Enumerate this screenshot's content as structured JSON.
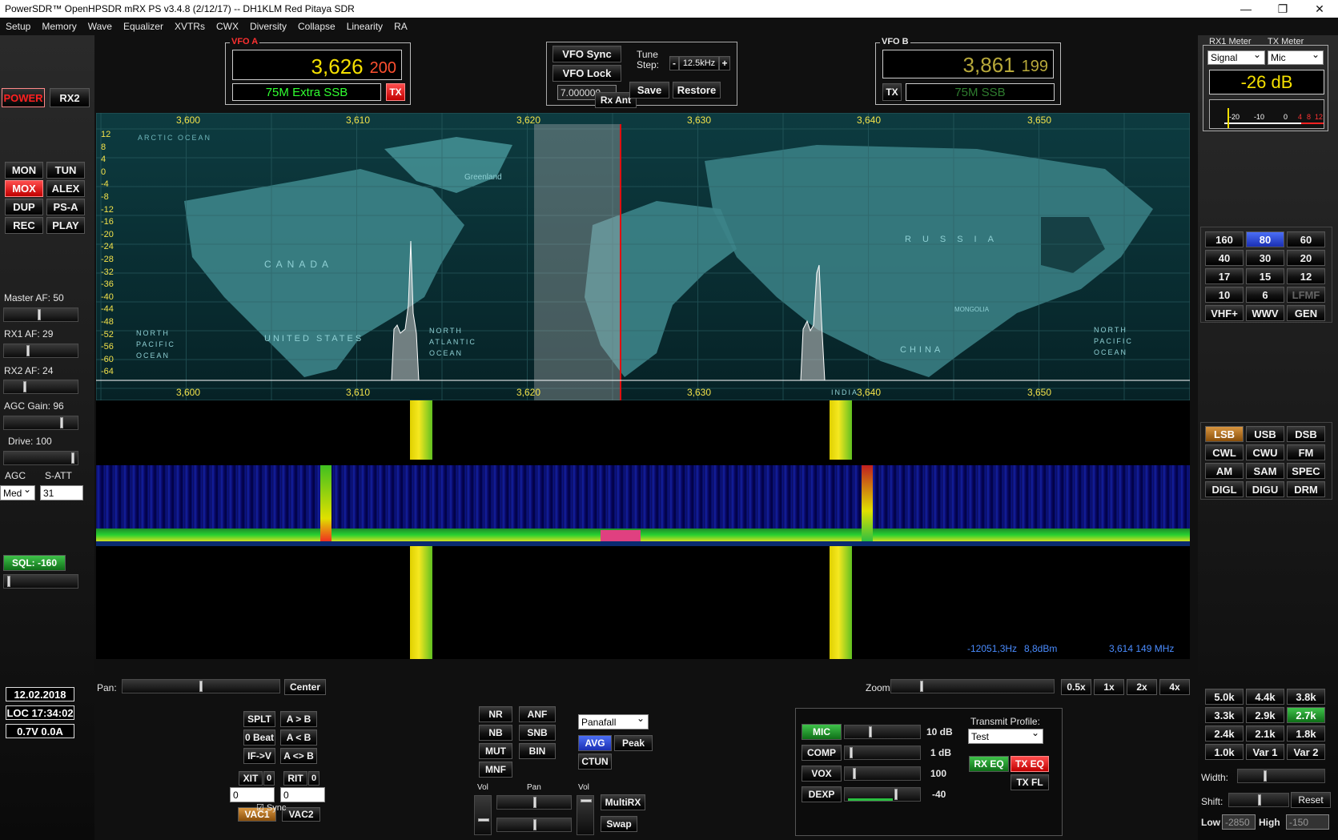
{
  "window": {
    "title": "PowerSDR™ OpenHPSDR mRX PS v3.4.8 (2/12/17)   --   DH1KLM Red Pitaya SDR",
    "minimize": "—",
    "maximize": "❐",
    "close": "✕"
  },
  "menu": [
    "Setup",
    "Memory",
    "Wave",
    "Equalizer",
    "XVTRs",
    "CWX",
    "Diversity",
    "Collapse",
    "Linearity",
    "RA"
  ],
  "power": {
    "power": "POWER",
    "rx2": "RX2"
  },
  "tx_buttons": [
    "MON",
    "TUN",
    "MOX",
    "ALEX",
    "DUP",
    "PS-A",
    "REC",
    "PLAY"
  ],
  "controls": {
    "master_af": "Master AF:  50",
    "rx1_af": "RX1 AF:  29",
    "rx2_af": "RX2 AF:  24",
    "agc_gain": "AGC Gain:  96",
    "drive": "Drive:  100",
    "agc": "AGC",
    "satt": "S-ATT",
    "agc_value": "Med",
    "satt_value": "31",
    "sql": "SQL: -160"
  },
  "status": {
    "date": "12.02.2018",
    "time": "LOC 17:34:02",
    "power": "0.7V 0.0A"
  },
  "vfo_a": {
    "caption": "VFO A",
    "mhz": "3,626",
    "hz": "200",
    "band": "75M Extra SSB",
    "tx": "TX"
  },
  "vfo_b": {
    "caption": "VFO B",
    "mhz": "3,861",
    "hz": "199",
    "band": "75M SSB",
    "tx": "TX"
  },
  "vfo_center": {
    "sync": "VFO Sync",
    "lock": "VFO Lock",
    "tune": "Tune",
    "step_label": "Step:",
    "minus": "-",
    "step": "12.5kHz",
    "plus": "+",
    "save": "Save",
    "restore": "Restore",
    "freq": "7.000000",
    "rx_ant": "Rx Ant"
  },
  "meter": {
    "rx1_label": "RX1 Meter",
    "tx_label": "TX Meter",
    "rx_sel": "Signal",
    "tx_sel": "Mic",
    "reading": "-26 dB",
    "scale": [
      "-20",
      "-10",
      "0",
      "4",
      "8",
      "12"
    ]
  },
  "bands": [
    "160",
    "80",
    "60",
    "40",
    "30",
    "20",
    "17",
    "15",
    "12",
    "10",
    "6",
    "LFMF",
    "VHF+",
    "WWV",
    "GEN"
  ],
  "modes": [
    "LSB",
    "USB",
    "DSB",
    "CWL",
    "CWU",
    "FM",
    "AM",
    "SAM",
    "SPEC",
    "DIGL",
    "DIGU",
    "DRM"
  ],
  "filters": [
    "5.0k",
    "4.4k",
    "3.8k",
    "3.3k",
    "2.9k",
    "2.7k",
    "2.4k",
    "2.1k",
    "1.8k",
    "1.0k",
    "Var 1",
    "Var 2"
  ],
  "filter_ctl": {
    "width": "Width:",
    "shift": "Shift:",
    "reset": "Reset",
    "low": "Low",
    "low_val": "-2850",
    "high": "High",
    "high_val": "-150"
  },
  "spectrum": {
    "freq_ticks": [
      "3,600",
      "3,610",
      "3,620",
      "3,630",
      "3,640",
      "3,650"
    ],
    "db_ticks": [
      "12",
      "8",
      "4",
      "0",
      "-4",
      "-8",
      "-12",
      "-16",
      "-20",
      "-24",
      "-28",
      "-32",
      "-36",
      "-40",
      "-44",
      "-48",
      "-52",
      "-56",
      "-60",
      "-64"
    ],
    "readout_hz": "-12051,3Hz",
    "readout_dbm": "8,8dBm",
    "readout_mhz": "3,614 149 MHz",
    "map_labels": [
      "ARCTIC OCEAN",
      "Greenland",
      "CANADA",
      "UNITED STATES",
      "NORTH PACIFIC OCEAN",
      "NORTH ATLANTIC OCEAN",
      "RUSSIA",
      "CHINA",
      "NORTH PACIFIC OCEAN",
      "MONGOLIA",
      "INDIA"
    ]
  },
  "pan": {
    "pan": "Pan:",
    "center": "Center",
    "zoom": "Zoom:",
    "zooms": [
      "0.5x",
      "1x",
      "2x",
      "4x"
    ]
  },
  "vfo_ops": [
    "SPLT",
    "A > B",
    "0 Beat",
    "A < B",
    "IF->V",
    "A <> B"
  ],
  "xit": {
    "xit": "XIT",
    "xit_val": "0",
    "rit": "RIT",
    "rit_val": "0",
    "xit_in": "0",
    "rit_in": "0",
    "sync": "Sync",
    "vac1": "VAC1",
    "vac2": "VAC2"
  },
  "dsp": [
    "NR",
    "ANF",
    "NB",
    "SNB",
    "MUT",
    "BIN",
    "MNF"
  ],
  "display": {
    "mode": "Panafall",
    "avg": "AVG",
    "peak": "Peak",
    "ctun": "CTUN"
  },
  "rx2_mix": {
    "vol": "Vol",
    "pan": "Pan",
    "vol2": "Vol",
    "multirx": "MultiRX",
    "swap": "Swap"
  },
  "tx_proc": {
    "mic": "MIC",
    "mic_val": "10 dB",
    "comp": "COMP",
    "comp_val": "1 dB",
    "vox": "VOX",
    "vox_val": "100",
    "dexp": "DEXP",
    "dexp_val": "-40",
    "profile_label": "Transmit Profile:",
    "profile": "Test",
    "rx_eq": "RX EQ",
    "tx_eq": "TX EQ",
    "tx_fl": "TX FL"
  }
}
